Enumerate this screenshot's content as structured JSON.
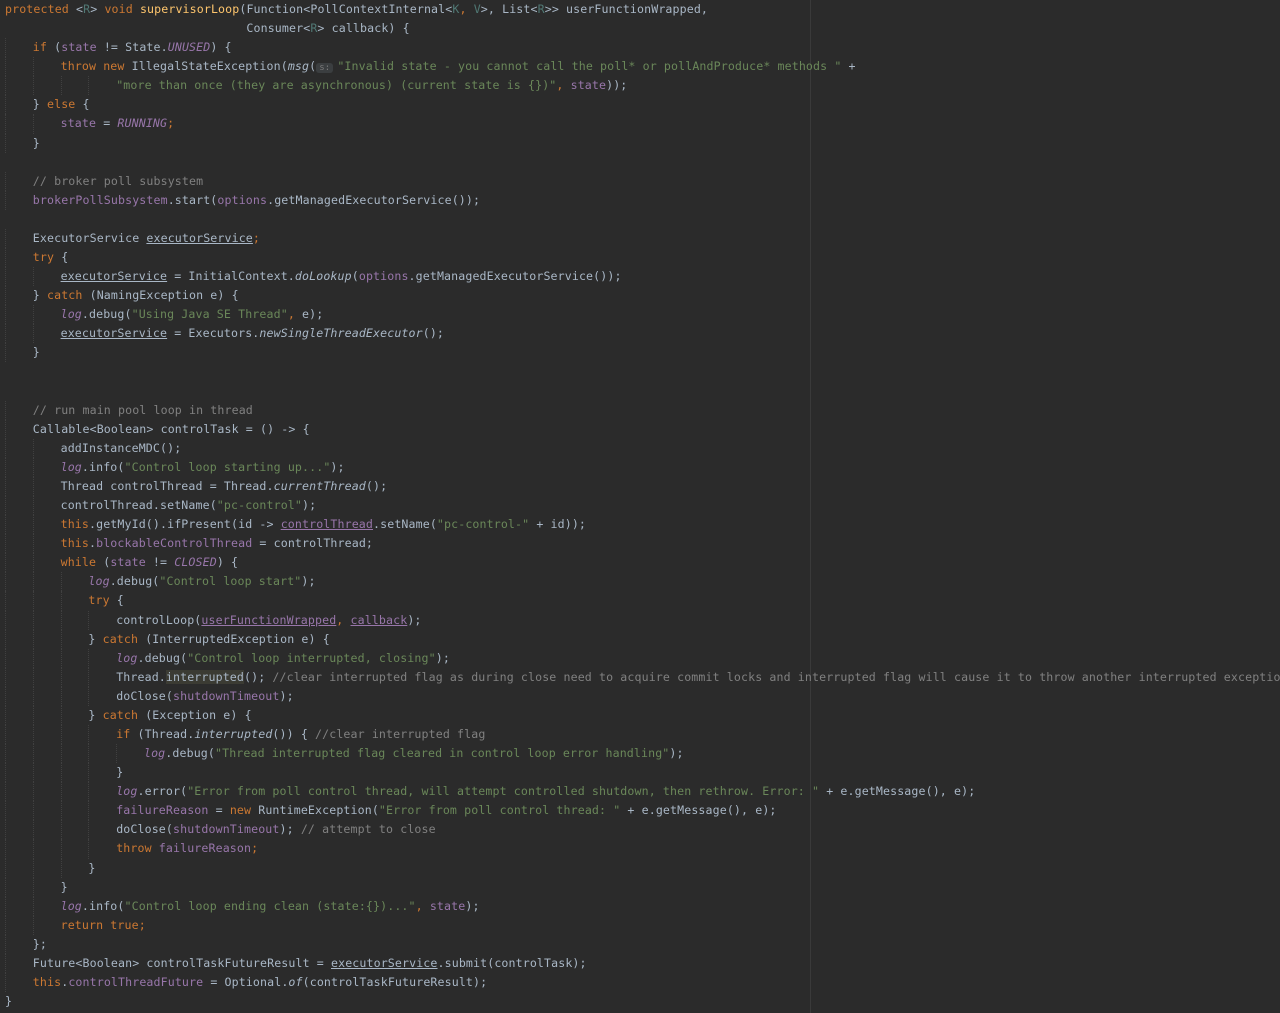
{
  "theme": {
    "background": "#2b2b2b",
    "default_text": "#a9b7c6",
    "keyword": "#cc7832",
    "string": "#6a8759",
    "comment": "#808080",
    "method_declaration": "#ffc66d",
    "field": "#9876aa",
    "generic_type": "#507874"
  },
  "code_lines": [
    {
      "indent": 0,
      "tokens": [
        {
          "t": "protected ",
          "c": "kw"
        },
        {
          "t": "<",
          "c": ""
        },
        {
          "t": "R",
          "c": "gen"
        },
        {
          "t": "> ",
          "c": ""
        },
        {
          "t": "void ",
          "c": "kw"
        },
        {
          "t": "supervisorLoop",
          "c": "fn"
        },
        {
          "t": "(Function<PollContextInternal<",
          "c": ""
        },
        {
          "t": "K",
          "c": "gen"
        },
        {
          "t": ", ",
          "c": "kw"
        },
        {
          "t": "V",
          "c": "gen"
        },
        {
          "t": ">, List<",
          "c": ""
        },
        {
          "t": "R",
          "c": "gen"
        },
        {
          "t": ">> userFunctionWrapped,",
          "c": ""
        }
      ]
    },
    {
      "indent": 0,
      "tokens": [
        {
          "t": "                                  Consumer<",
          "c": ""
        },
        {
          "t": "R",
          "c": "gen"
        },
        {
          "t": "> callback) {",
          "c": ""
        }
      ]
    },
    {
      "indent": 1,
      "tokens": [
        {
          "t": "if ",
          "c": "kw"
        },
        {
          "t": "(",
          "c": ""
        },
        {
          "t": "state",
          "c": "fld"
        },
        {
          "t": " != State.",
          "c": ""
        },
        {
          "t": "UNUSED",
          "c": "itf"
        },
        {
          "t": ") {",
          "c": ""
        }
      ]
    },
    {
      "indent": 2,
      "tokens": [
        {
          "t": "throw new ",
          "c": "kw"
        },
        {
          "t": "IllegalStateException(",
          "c": ""
        },
        {
          "t": "msg",
          "c": "italic"
        },
        {
          "t": "(",
          "c": ""
        },
        {
          "t": "s:",
          "c": "hint"
        },
        {
          "t": "\"Invalid state - you cannot call the poll* or pollAndProduce* methods \"",
          "c": "str"
        },
        {
          "t": " +",
          "c": ""
        }
      ]
    },
    {
      "indent": 4,
      "tokens": [
        {
          "t": "\"more than once (they are asynchronous) (current state is {})\"",
          "c": "str"
        },
        {
          "t": ", ",
          "c": "kw"
        },
        {
          "t": "state",
          "c": "fld"
        },
        {
          "t": "));",
          "c": ""
        }
      ]
    },
    {
      "indent": 1,
      "tokens": [
        {
          "t": "} ",
          "c": ""
        },
        {
          "t": "else ",
          "c": "kw"
        },
        {
          "t": "{",
          "c": ""
        }
      ]
    },
    {
      "indent": 2,
      "tokens": [
        {
          "t": "state",
          "c": "fld"
        },
        {
          "t": " = ",
          "c": ""
        },
        {
          "t": "RUNNING",
          "c": "itf"
        },
        {
          "t": ";",
          "c": "kw"
        }
      ]
    },
    {
      "indent": 1,
      "tokens": [
        {
          "t": "}",
          "c": ""
        }
      ]
    },
    {
      "indent": 0,
      "tokens": []
    },
    {
      "indent": 1,
      "tokens": [
        {
          "t": "// broker poll subsystem",
          "c": "cmt"
        }
      ]
    },
    {
      "indent": 1,
      "tokens": [
        {
          "t": "brokerPollSubsystem",
          "c": "fld"
        },
        {
          "t": ".start(",
          "c": ""
        },
        {
          "t": "options",
          "c": "fld"
        },
        {
          "t": ".getManagedExecutorService());",
          "c": ""
        }
      ]
    },
    {
      "indent": 0,
      "tokens": []
    },
    {
      "indent": 1,
      "tokens": [
        {
          "t": "ExecutorService ",
          "c": ""
        },
        {
          "t": "executorService",
          "c": "ul"
        },
        {
          "t": ";",
          "c": "kw"
        }
      ]
    },
    {
      "indent": 1,
      "tokens": [
        {
          "t": "try ",
          "c": "kw"
        },
        {
          "t": "{",
          "c": ""
        }
      ]
    },
    {
      "indent": 2,
      "tokens": [
        {
          "t": "executorService",
          "c": "ul"
        },
        {
          "t": " = InitialContext.",
          "c": ""
        },
        {
          "t": "doLookup",
          "c": "italic"
        },
        {
          "t": "(",
          "c": ""
        },
        {
          "t": "options",
          "c": "fld"
        },
        {
          "t": ".getManagedExecutorService());",
          "c": ""
        }
      ]
    },
    {
      "indent": 1,
      "tokens": [
        {
          "t": "} ",
          "c": ""
        },
        {
          "t": "catch ",
          "c": "kw"
        },
        {
          "t": "(NamingException e) {",
          "c": ""
        }
      ]
    },
    {
      "indent": 2,
      "tokens": [
        {
          "t": "log",
          "c": "itf"
        },
        {
          "t": ".debug(",
          "c": ""
        },
        {
          "t": "\"Using Java SE Thread\"",
          "c": "str"
        },
        {
          "t": ", ",
          "c": "kw"
        },
        {
          "t": "e);",
          "c": ""
        }
      ]
    },
    {
      "indent": 2,
      "tokens": [
        {
          "t": "executorService",
          "c": "ul"
        },
        {
          "t": " = Executors.",
          "c": ""
        },
        {
          "t": "newSingleThreadExecutor",
          "c": "italic"
        },
        {
          "t": "();",
          "c": ""
        }
      ]
    },
    {
      "indent": 1,
      "tokens": [
        {
          "t": "}",
          "c": ""
        }
      ]
    },
    {
      "indent": 0,
      "tokens": []
    },
    {
      "indent": 0,
      "tokens": []
    },
    {
      "indent": 1,
      "tokens": [
        {
          "t": "// run main pool loop in thread",
          "c": "cmt"
        }
      ]
    },
    {
      "indent": 1,
      "tokens": [
        {
          "t": "Callable<Boolean> controlTask = () -> {",
          "c": ""
        }
      ]
    },
    {
      "indent": 2,
      "tokens": [
        {
          "t": "addInstanceMDC();",
          "c": ""
        }
      ]
    },
    {
      "indent": 2,
      "tokens": [
        {
          "t": "log",
          "c": "itf"
        },
        {
          "t": ".info(",
          "c": ""
        },
        {
          "t": "\"Control loop starting up...\"",
          "c": "str"
        },
        {
          "t": ");",
          "c": ""
        }
      ]
    },
    {
      "indent": 2,
      "tokens": [
        {
          "t": "Thread controlThread = Thread.",
          "c": ""
        },
        {
          "t": "currentThread",
          "c": "italic"
        },
        {
          "t": "();",
          "c": ""
        }
      ]
    },
    {
      "indent": 2,
      "tokens": [
        {
          "t": "controlThread.setName(",
          "c": ""
        },
        {
          "t": "\"pc-control\"",
          "c": "str"
        },
        {
          "t": ");",
          "c": ""
        }
      ]
    },
    {
      "indent": 2,
      "tokens": [
        {
          "t": "this",
          "c": "kw"
        },
        {
          "t": ".getMyId().ifPresent(id -> ",
          "c": ""
        },
        {
          "t": "controlThread",
          "c": "ulp"
        },
        {
          "t": ".setName(",
          "c": ""
        },
        {
          "t": "\"pc-control-\"",
          "c": "str"
        },
        {
          "t": " + id));",
          "c": ""
        }
      ]
    },
    {
      "indent": 2,
      "tokens": [
        {
          "t": "this",
          "c": "kw"
        },
        {
          "t": ".",
          "c": ""
        },
        {
          "t": "blockableControlThread",
          "c": "fld"
        },
        {
          "t": " = controlThread;",
          "c": ""
        }
      ]
    },
    {
      "indent": 2,
      "tokens": [
        {
          "t": "while ",
          "c": "kw"
        },
        {
          "t": "(",
          "c": ""
        },
        {
          "t": "state",
          "c": "fld"
        },
        {
          "t": " != ",
          "c": ""
        },
        {
          "t": "CLOSED",
          "c": "itf"
        },
        {
          "t": ") {",
          "c": ""
        }
      ]
    },
    {
      "indent": 3,
      "tokens": [
        {
          "t": "log",
          "c": "itf"
        },
        {
          "t": ".debug(",
          "c": ""
        },
        {
          "t": "\"Control loop start\"",
          "c": "str"
        },
        {
          "t": ");",
          "c": ""
        }
      ]
    },
    {
      "indent": 3,
      "tokens": [
        {
          "t": "try ",
          "c": "kw"
        },
        {
          "t": "{",
          "c": ""
        }
      ]
    },
    {
      "indent": 4,
      "tokens": [
        {
          "t": "controlLoop(",
          "c": ""
        },
        {
          "t": "userFunctionWrapped",
          "c": "ulp"
        },
        {
          "t": ", ",
          "c": "kw"
        },
        {
          "t": "callback",
          "c": "ulp"
        },
        {
          "t": ");",
          "c": ""
        }
      ]
    },
    {
      "indent": 3,
      "tokens": [
        {
          "t": "} ",
          "c": ""
        },
        {
          "t": "catch ",
          "c": "kw"
        },
        {
          "t": "(InterruptedException e) {",
          "c": ""
        }
      ]
    },
    {
      "indent": 4,
      "tokens": [
        {
          "t": "log",
          "c": "itf"
        },
        {
          "t": ".debug(",
          "c": ""
        },
        {
          "t": "\"Control loop interrupted, closing\"",
          "c": "str"
        },
        {
          "t": ");",
          "c": ""
        }
      ]
    },
    {
      "indent": 4,
      "tokens": [
        {
          "t": "Thread.",
          "c": ""
        },
        {
          "t": "interrupted",
          "c": "hl"
        },
        {
          "t": "(); ",
          "c": ""
        },
        {
          "t": "//clear interrupted flag as during close need to acquire commit locks and interrupted flag will cause it to throw another interrupted exception.",
          "c": "cmt"
        }
      ]
    },
    {
      "indent": 4,
      "tokens": [
        {
          "t": "doClose(",
          "c": ""
        },
        {
          "t": "shutdownTimeout",
          "c": "fld"
        },
        {
          "t": ");",
          "c": ""
        }
      ]
    },
    {
      "indent": 3,
      "tokens": [
        {
          "t": "} ",
          "c": ""
        },
        {
          "t": "catch ",
          "c": "kw"
        },
        {
          "t": "(Exception e) {",
          "c": ""
        }
      ]
    },
    {
      "indent": 4,
      "tokens": [
        {
          "t": "if ",
          "c": "kw"
        },
        {
          "t": "(Thread.",
          "c": ""
        },
        {
          "t": "interrupted",
          "c": "italic"
        },
        {
          "t": "()) { ",
          "c": ""
        },
        {
          "t": "//clear interrupted flag",
          "c": "cmt"
        }
      ]
    },
    {
      "indent": 5,
      "tokens": [
        {
          "t": "log",
          "c": "itf"
        },
        {
          "t": ".debug(",
          "c": ""
        },
        {
          "t": "\"Thread interrupted flag cleared in control loop error handling\"",
          "c": "str"
        },
        {
          "t": ");",
          "c": ""
        }
      ]
    },
    {
      "indent": 4,
      "tokens": [
        {
          "t": "}",
          "c": ""
        }
      ]
    },
    {
      "indent": 4,
      "tokens": [
        {
          "t": "log",
          "c": "itf"
        },
        {
          "t": ".error(",
          "c": ""
        },
        {
          "t": "\"Error from poll control thread, will attempt controlled shutdown, then rethrow. Error: \"",
          "c": "str"
        },
        {
          "t": " + e.getMessage(), e);",
          "c": ""
        }
      ]
    },
    {
      "indent": 4,
      "tokens": [
        {
          "t": "failureReason",
          "c": "fld"
        },
        {
          "t": " = ",
          "c": ""
        },
        {
          "t": "new ",
          "c": "kw"
        },
        {
          "t": "RuntimeException(",
          "c": ""
        },
        {
          "t": "\"Error from poll control thread: \"",
          "c": "str"
        },
        {
          "t": " + e.getMessage(), e);",
          "c": ""
        }
      ]
    },
    {
      "indent": 4,
      "tokens": [
        {
          "t": "doClose(",
          "c": ""
        },
        {
          "t": "shutdownTimeout",
          "c": "fld"
        },
        {
          "t": "); ",
          "c": ""
        },
        {
          "t": "// attempt to close",
          "c": "cmt"
        }
      ]
    },
    {
      "indent": 4,
      "tokens": [
        {
          "t": "throw ",
          "c": "kw"
        },
        {
          "t": "failureReason",
          "c": "fld"
        },
        {
          "t": ";",
          "c": "kw"
        }
      ]
    },
    {
      "indent": 3,
      "tokens": [
        {
          "t": "}",
          "c": ""
        }
      ]
    },
    {
      "indent": 2,
      "tokens": [
        {
          "t": "}",
          "c": ""
        }
      ]
    },
    {
      "indent": 2,
      "tokens": [
        {
          "t": "log",
          "c": "itf"
        },
        {
          "t": ".info(",
          "c": ""
        },
        {
          "t": "\"Control loop ending clean (state:{})...\"",
          "c": "str"
        },
        {
          "t": ", ",
          "c": "kw"
        },
        {
          "t": "state",
          "c": "fld"
        },
        {
          "t": ");",
          "c": ""
        }
      ]
    },
    {
      "indent": 2,
      "tokens": [
        {
          "t": "return true",
          "c": "kw"
        },
        {
          "t": ";",
          "c": "kw"
        }
      ]
    },
    {
      "indent": 1,
      "tokens": [
        {
          "t": "};",
          "c": ""
        }
      ]
    },
    {
      "indent": 1,
      "tokens": [
        {
          "t": "Future<Boolean> controlTaskFutureResult = ",
          "c": ""
        },
        {
          "t": "executorService",
          "c": "ul"
        },
        {
          "t": ".submit(controlTask);",
          "c": ""
        }
      ]
    },
    {
      "indent": 1,
      "tokens": [
        {
          "t": "this",
          "c": "kw"
        },
        {
          "t": ".",
          "c": ""
        },
        {
          "t": "controlThreadFuture",
          "c": "fld"
        },
        {
          "t": " = Optional.",
          "c": ""
        },
        {
          "t": "of",
          "c": "italic"
        },
        {
          "t": "(controlTaskFutureResult);",
          "c": ""
        }
      ]
    },
    {
      "indent": 0,
      "tokens": [
        {
          "t": "}",
          "c": ""
        }
      ]
    }
  ]
}
